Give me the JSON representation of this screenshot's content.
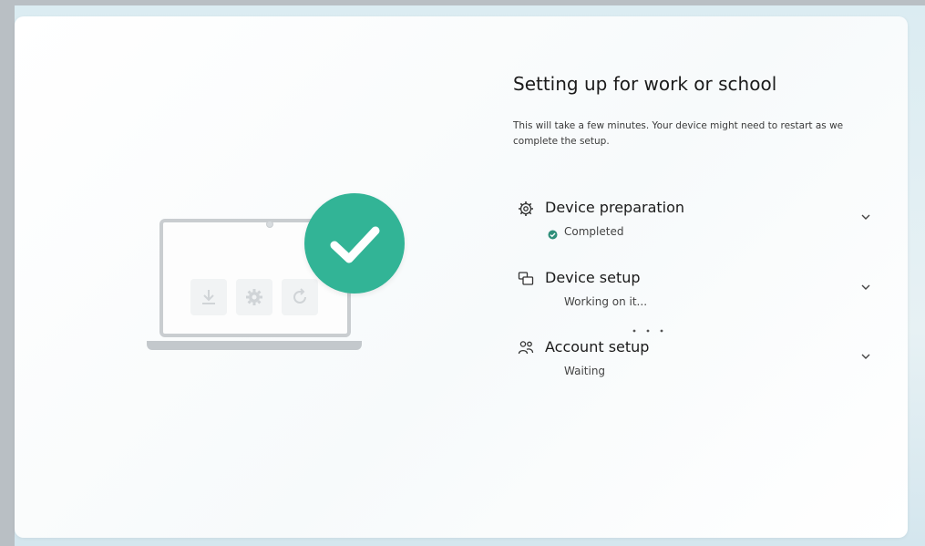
{
  "page": {
    "title": "Setting up for work or school",
    "description": "This will take a few minutes. Your device might need to restart as we complete the setup."
  },
  "steps": [
    {
      "title": "Device preparation",
      "status": "Completed",
      "icon": "gear-icon",
      "state": "completed"
    },
    {
      "title": "Device setup",
      "status": "Working on it...",
      "icon": "devices-icon",
      "state": "in-progress"
    },
    {
      "title": "Account setup",
      "status": "Waiting",
      "icon": "people-icon",
      "state": "waiting"
    }
  ],
  "colors": {
    "accent": "#32b496",
    "completed": "#2f8f7a"
  }
}
